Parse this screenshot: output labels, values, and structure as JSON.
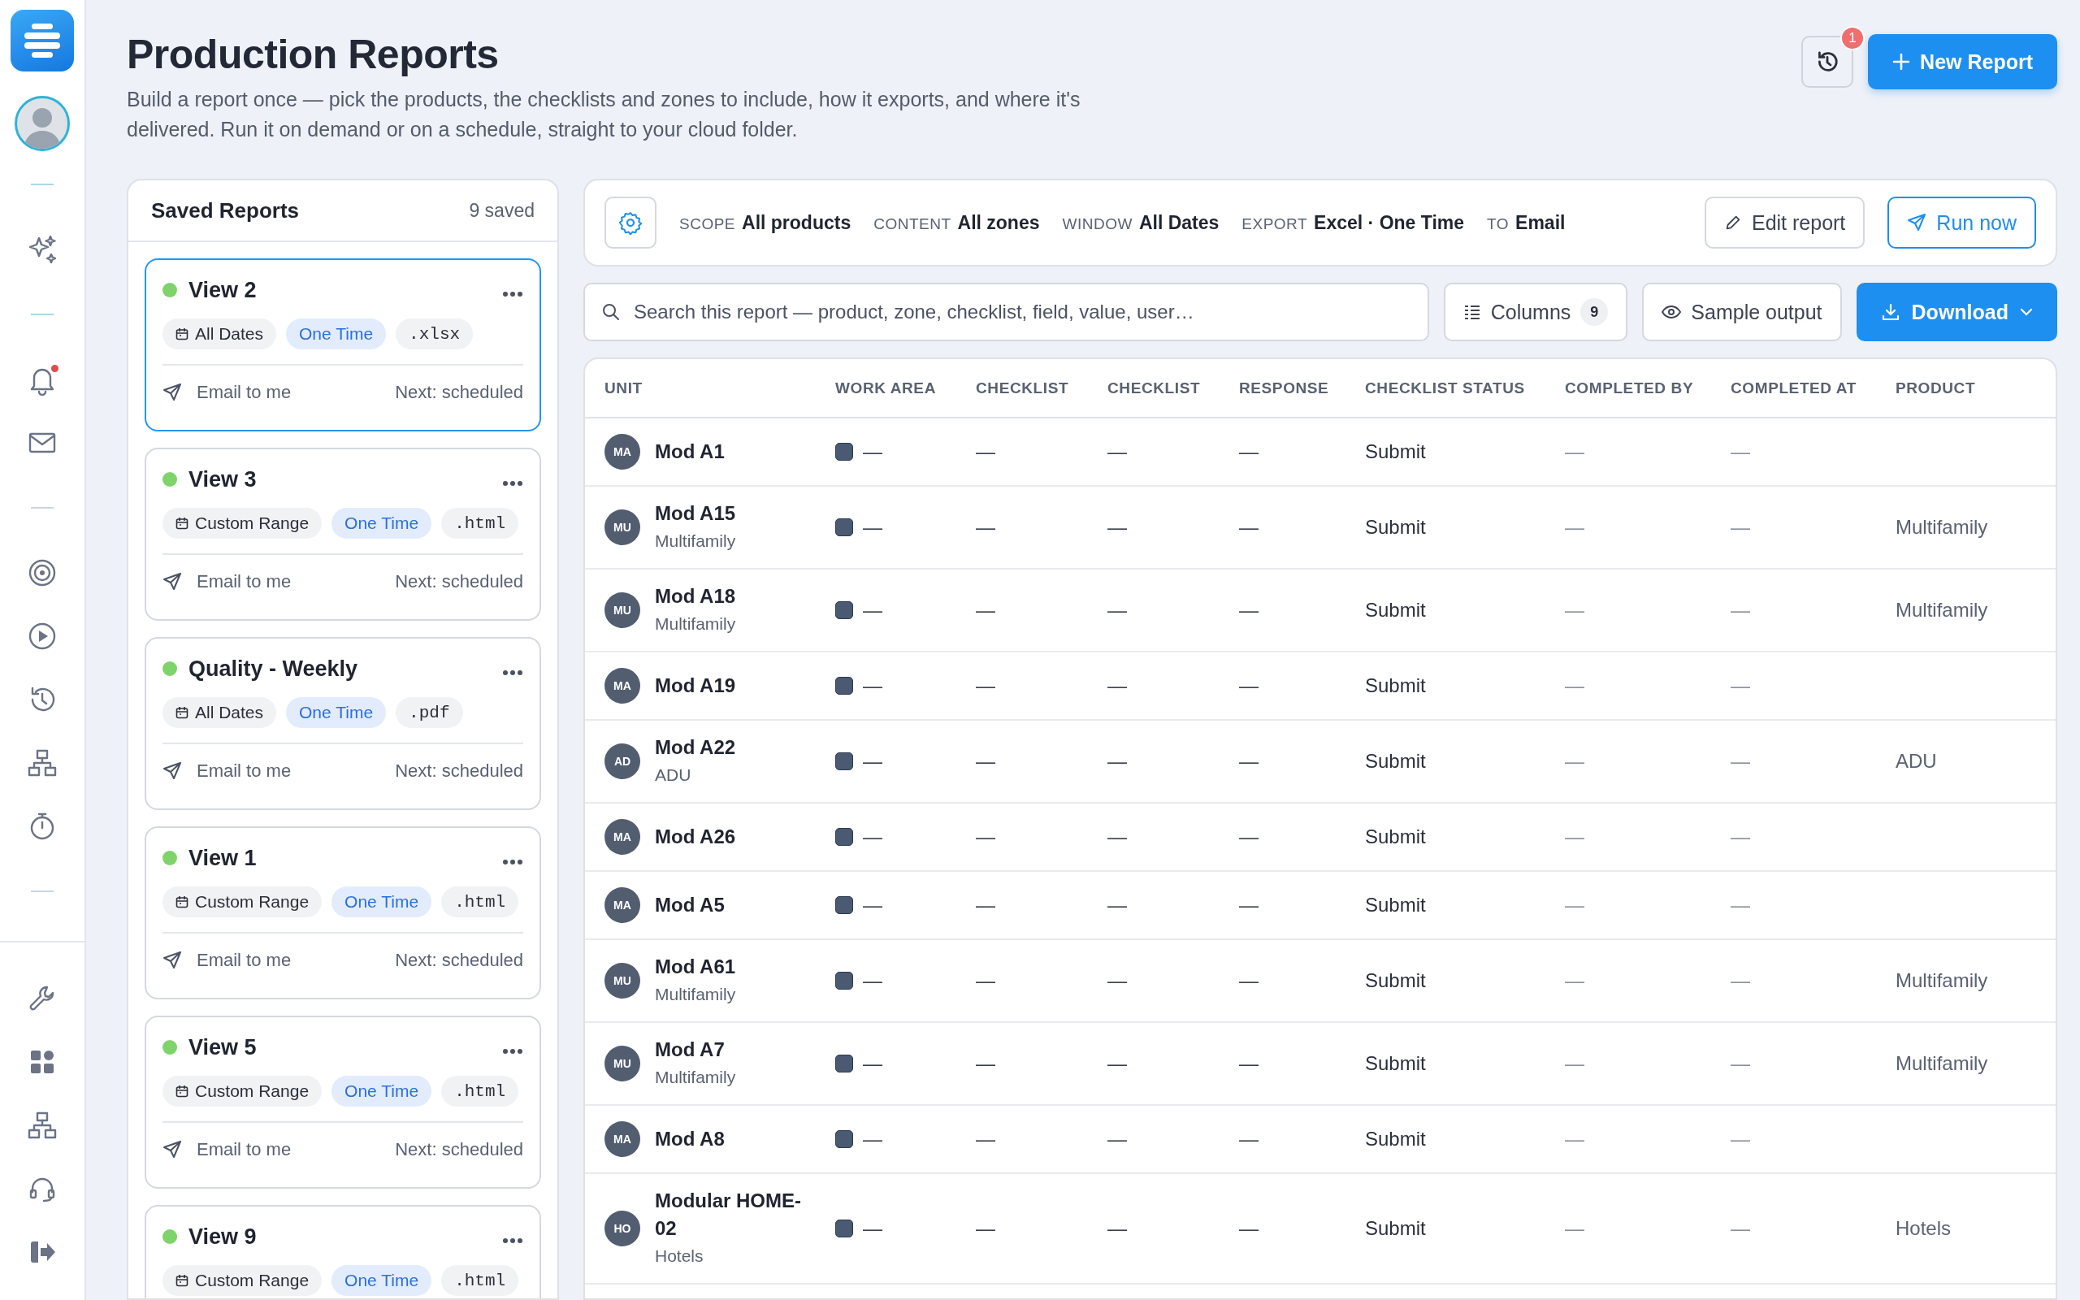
{
  "sidebar": {
    "bell_unread": true
  },
  "header": {
    "title": "Production Reports",
    "description": "Build a report once — pick the products, the checklists and zones to include, how it exports, and where it's delivered. Run it on demand or on a schedule, straight to your cloud folder.",
    "history_badge": "1",
    "new_button": "New Report"
  },
  "saved_reports": {
    "title": "Saved Reports",
    "count": "9 saved",
    "items": [
      {
        "name": "View 2",
        "range": "All Dates",
        "frequency": "One Time",
        "format": ".xlsx",
        "delivery": "Email to me",
        "next": "Next: scheduled",
        "selected": true
      },
      {
        "name": "View 3",
        "range": "Custom Range",
        "frequency": "One Time",
        "format": ".html",
        "delivery": "Email to me",
        "next": "Next: scheduled",
        "selected": false
      },
      {
        "name": "Quality - Weekly",
        "range": "All Dates",
        "frequency": "One Time",
        "format": ".pdf",
        "delivery": "Email to me",
        "next": "Next: scheduled",
        "selected": false
      },
      {
        "name": "View 1",
        "range": "Custom Range",
        "frequency": "One Time",
        "format": ".html",
        "delivery": "Email to me",
        "next": "Next: scheduled",
        "selected": false
      },
      {
        "name": "View 5",
        "range": "Custom Range",
        "frequency": "One Time",
        "format": ".html",
        "delivery": "Email to me",
        "next": "Next: scheduled",
        "selected": false
      },
      {
        "name": "View 9",
        "range": "Custom Range",
        "frequency": "One Time",
        "format": ".html",
        "selected": false
      }
    ]
  },
  "summary": {
    "fields": [
      {
        "label": "SCOPE",
        "value": "All products"
      },
      {
        "label": "CONTENT",
        "value": "All zones"
      },
      {
        "label": "WINDOW",
        "value": "All Dates"
      },
      {
        "label": "EXPORT",
        "value": "Excel · One Time"
      },
      {
        "label": "TO",
        "value": "Email"
      }
    ],
    "edit_button": "Edit report",
    "run_button": "Run now"
  },
  "toolbar": {
    "search": {
      "placeholder": "Search this report — product, zone, checklist, field, value, user…"
    },
    "columns_button": "Columns",
    "columns_count": "9",
    "sample_button": "Sample output",
    "download_button": "Download"
  },
  "table": {
    "columns": [
      "UNIT",
      "WORK AREA",
      "CHECKLIST",
      "CHECKLIST",
      "RESPONSE",
      "CHECKLIST STATUS",
      "COMPLETED BY",
      "COMPLETED AT",
      "PRODUCT"
    ],
    "rows": [
      {
        "initials": "MA",
        "unit": "Mod A1",
        "work_area": "—",
        "checklist_1": "—",
        "checklist_2": "—",
        "response": "—",
        "status": "Submit",
        "completed_by": "—",
        "completed_at": "—"
      },
      {
        "initials": "MU",
        "unit": "Mod A15",
        "unit_sub": "Multifamily",
        "work_area": "—",
        "checklist_1": "—",
        "checklist_2": "—",
        "response": "—",
        "status": "Submit",
        "completed_by": "—",
        "completed_at": "—",
        "product": "Multifamily"
      },
      {
        "initials": "MU",
        "unit": "Mod A18",
        "unit_sub": "Multifamily",
        "work_area": "—",
        "checklist_1": "—",
        "checklist_2": "—",
        "response": "—",
        "status": "Submit",
        "completed_by": "—",
        "completed_at": "—",
        "product": "Multifamily"
      },
      {
        "initials": "MA",
        "unit": "Mod A19",
        "work_area": "—",
        "checklist_1": "—",
        "checklist_2": "—",
        "response": "—",
        "status": "Submit",
        "completed_by": "—",
        "completed_at": "—"
      },
      {
        "initials": "AD",
        "unit": "Mod A22",
        "unit_sub": "ADU",
        "work_area": "—",
        "checklist_1": "—",
        "checklist_2": "—",
        "response": "—",
        "status": "Submit",
        "completed_by": "—",
        "completed_at": "—",
        "product": "ADU"
      },
      {
        "initials": "MA",
        "unit": "Mod A26",
        "work_area": "—",
        "checklist_1": "—",
        "checklist_2": "—",
        "response": "—",
        "status": "Submit",
        "completed_by": "—",
        "completed_at": "—"
      },
      {
        "initials": "MA",
        "unit": "Mod A5",
        "work_area": "—",
        "checklist_1": "—",
        "checklist_2": "—",
        "response": "—",
        "status": "Submit",
        "completed_by": "—",
        "completed_at": "—"
      },
      {
        "initials": "MU",
        "unit": "Mod A61",
        "unit_sub": "Multifamily",
        "work_area": "—",
        "checklist_1": "—",
        "checklist_2": "—",
        "response": "—",
        "status": "Submit",
        "completed_by": "—",
        "completed_at": "—",
        "product": "Multifamily"
      },
      {
        "initials": "MU",
        "unit": "Mod A7",
        "unit_sub": "Multifamily",
        "work_area": "—",
        "checklist_1": "—",
        "checklist_2": "—",
        "response": "—",
        "status": "Submit",
        "completed_by": "—",
        "completed_at": "—",
        "product": "Multifamily"
      },
      {
        "initials": "MA",
        "unit": "Mod A8",
        "work_area": "—",
        "checklist_1": "—",
        "checklist_2": "—",
        "response": "—",
        "status": "Submit",
        "completed_by": "—",
        "completed_at": "—"
      },
      {
        "initials": "HO",
        "unit": "Modular HOME-02",
        "unit_sub": "Hotels",
        "work_area": "—",
        "checklist_1": "—",
        "checklist_2": "—",
        "response": "—",
        "status": "Submit",
        "completed_by": "—",
        "completed_at": "—",
        "product": "Hotels"
      }
    ]
  }
}
